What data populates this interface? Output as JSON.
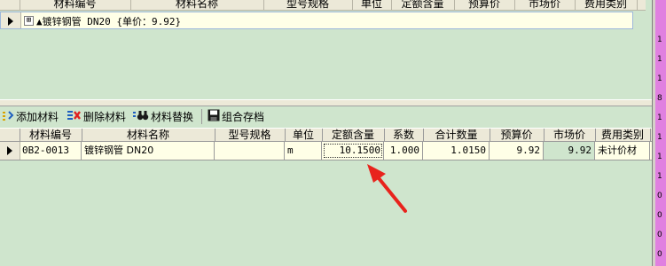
{
  "top_grid": {
    "columns": [
      "材料编号",
      "材料名称",
      "型号规格",
      "单位",
      "定额含量",
      "预算价",
      "市场价",
      "费用类别"
    ],
    "row": {
      "expand_symbol": "⊞",
      "text": "▲镀锌钢管 DN20 {单价：9.92}"
    }
  },
  "toolbar": {
    "add_label": "添加材料",
    "delete_label": "删除材料",
    "replace_label": "材料替换",
    "save_label": "组合存档"
  },
  "bottom_grid": {
    "columns": [
      "材料编号",
      "材料名称",
      "型号规格",
      "单位",
      "定额含量",
      "系数",
      "合计数量",
      "预算价",
      "市场价",
      "费用类别"
    ],
    "row": {
      "code": "0B2-0013",
      "name": "镀锌钢管 DN20",
      "spec": "",
      "unit": "m",
      "quota_amount": "10.1500",
      "factor": "1.000",
      "total_qty": "1.0150",
      "budget_price": "9.92",
      "market_price": "9.92",
      "cost_type": "未计价材"
    }
  },
  "edge_digits": [
    "1",
    "1",
    "1",
    "8",
    "1",
    "1",
    "1",
    "1",
    "0",
    "0",
    "0",
    "0"
  ],
  "colors": {
    "background": "#cfe5cd",
    "row_highlight": "#ffffe7",
    "annotation_arrow": "#e8231c",
    "edge_strip": "#e080e0"
  }
}
